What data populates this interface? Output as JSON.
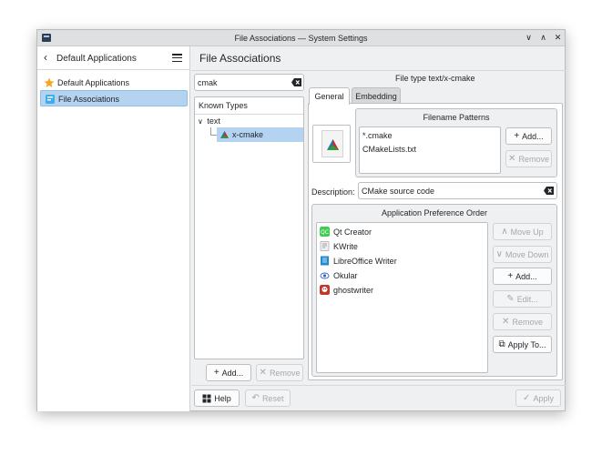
{
  "window": {
    "title": "File Associations — System Settings"
  },
  "sidebar": {
    "title": "Default Applications",
    "items": [
      {
        "label": "Default Applications",
        "icon": "star-icon"
      },
      {
        "label": "File Associations",
        "icon": "file-associations-icon",
        "selected": true
      }
    ]
  },
  "content": {
    "title": "File Associations"
  },
  "search": {
    "value": "cmak"
  },
  "known_types": {
    "header": "Known Types",
    "group": "text",
    "selected_item": "x-cmake"
  },
  "left_buttons": {
    "add": "Add...",
    "remove": "Remove"
  },
  "file_type_label": "File type text/x-cmake",
  "tabs": [
    {
      "label": "General",
      "active": true
    },
    {
      "label": "Embedding",
      "active": false
    }
  ],
  "filename_patterns": {
    "title": "Filename Patterns",
    "items": [
      "*.cmake",
      "CMakeLists.txt"
    ],
    "add": "Add...",
    "remove": "Remove"
  },
  "description": {
    "label": "Description:",
    "value": "CMake source code"
  },
  "app_pref": {
    "title": "Application Preference Order",
    "apps": [
      {
        "name": "Qt Creator",
        "icon": "qt-creator-icon"
      },
      {
        "name": "KWrite",
        "icon": "kwrite-icon"
      },
      {
        "name": "LibreOffice Writer",
        "icon": "libreoffice-writer-icon"
      },
      {
        "name": "Okular",
        "icon": "okular-icon"
      },
      {
        "name": "ghostwriter",
        "icon": "ghostwriter-icon"
      }
    ],
    "buttons": {
      "move_up": "Move Up",
      "move_down": "Move Down",
      "add": "Add...",
      "edit": "Edit...",
      "remove": "Remove",
      "apply_to": "Apply To..."
    }
  },
  "footer": {
    "help": "Help",
    "reset": "Reset",
    "apply": "Apply"
  },
  "colors": {
    "selection": "#b3d3f0",
    "accent": "#3daee9",
    "window_bg": "#eff0f1"
  }
}
